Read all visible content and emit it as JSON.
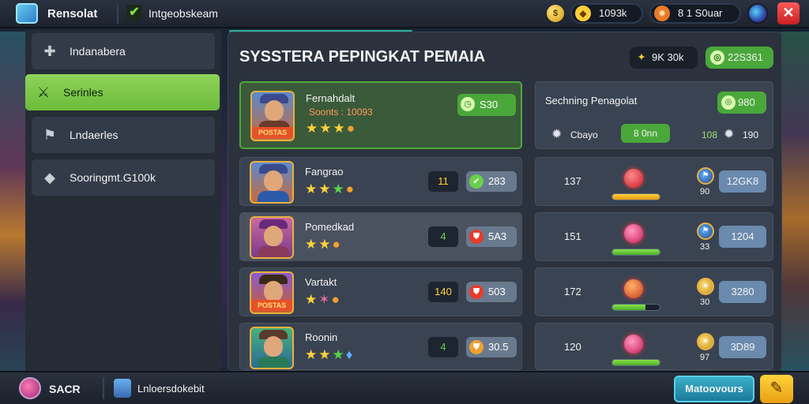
{
  "topbar": {
    "title": "Rensolat",
    "subtitle": "Intgeobskeam",
    "currency1": "1093k",
    "currency2": "8 1 S0uar"
  },
  "sidebar": {
    "items": [
      {
        "label": "Indanabera",
        "icon": "puzzle-icon"
      },
      {
        "label": "Serinles",
        "icon": "sword-icon"
      },
      {
        "label": "Lndaerles",
        "icon": "flag-icon"
      },
      {
        "label": "Sooringmt.G100k",
        "icon": "tag-icon"
      }
    ],
    "active_index": 1
  },
  "main": {
    "title": "SYSSTERA PEPINGKAT PEMAIA",
    "header_pill1": "9K 30k",
    "header_pill2": "22S361",
    "featured": {
      "name": "Fernahdalt",
      "sub": "Soonts : 10093",
      "banner": "POSTAS",
      "value": "S30",
      "stars": 3
    },
    "summary": {
      "title": "Sechning Penagolat",
      "pill": "980",
      "left_label": "Cbayo",
      "center_pill": "8 0nn",
      "right_value": "108",
      "right_number": "190"
    },
    "rows": [
      {
        "name": "Fangrao",
        "box": "11",
        "value": "283",
        "stat_num": "137",
        "stat_medal": "90",
        "stat_pill": "12GK8",
        "bar_fill": 1.0,
        "bar_color": "yellow"
      },
      {
        "name": "Pomedkad",
        "box": "4",
        "value": "5A3",
        "stat_num": "151",
        "stat_medal": "33",
        "stat_pill": "1204",
        "bar_fill": 1.0,
        "bar_color": "green"
      },
      {
        "name": "Vartakt",
        "box": "140",
        "value": "503",
        "stat_num": "172",
        "stat_medal": "30",
        "stat_pill": "3280",
        "bar_fill": 0.7,
        "bar_color": "green",
        "banner": "POSTAS"
      },
      {
        "name": "Roonin",
        "box": "4",
        "value": "30.5",
        "stat_num": "120",
        "stat_medal": "97",
        "stat_pill": "3D89",
        "bar_fill": 1.0,
        "bar_color": "green"
      }
    ]
  },
  "bottom": {
    "left_label": "SACR",
    "file_label": "Lnloersdokebit",
    "confirm_label": "Matoovours"
  }
}
